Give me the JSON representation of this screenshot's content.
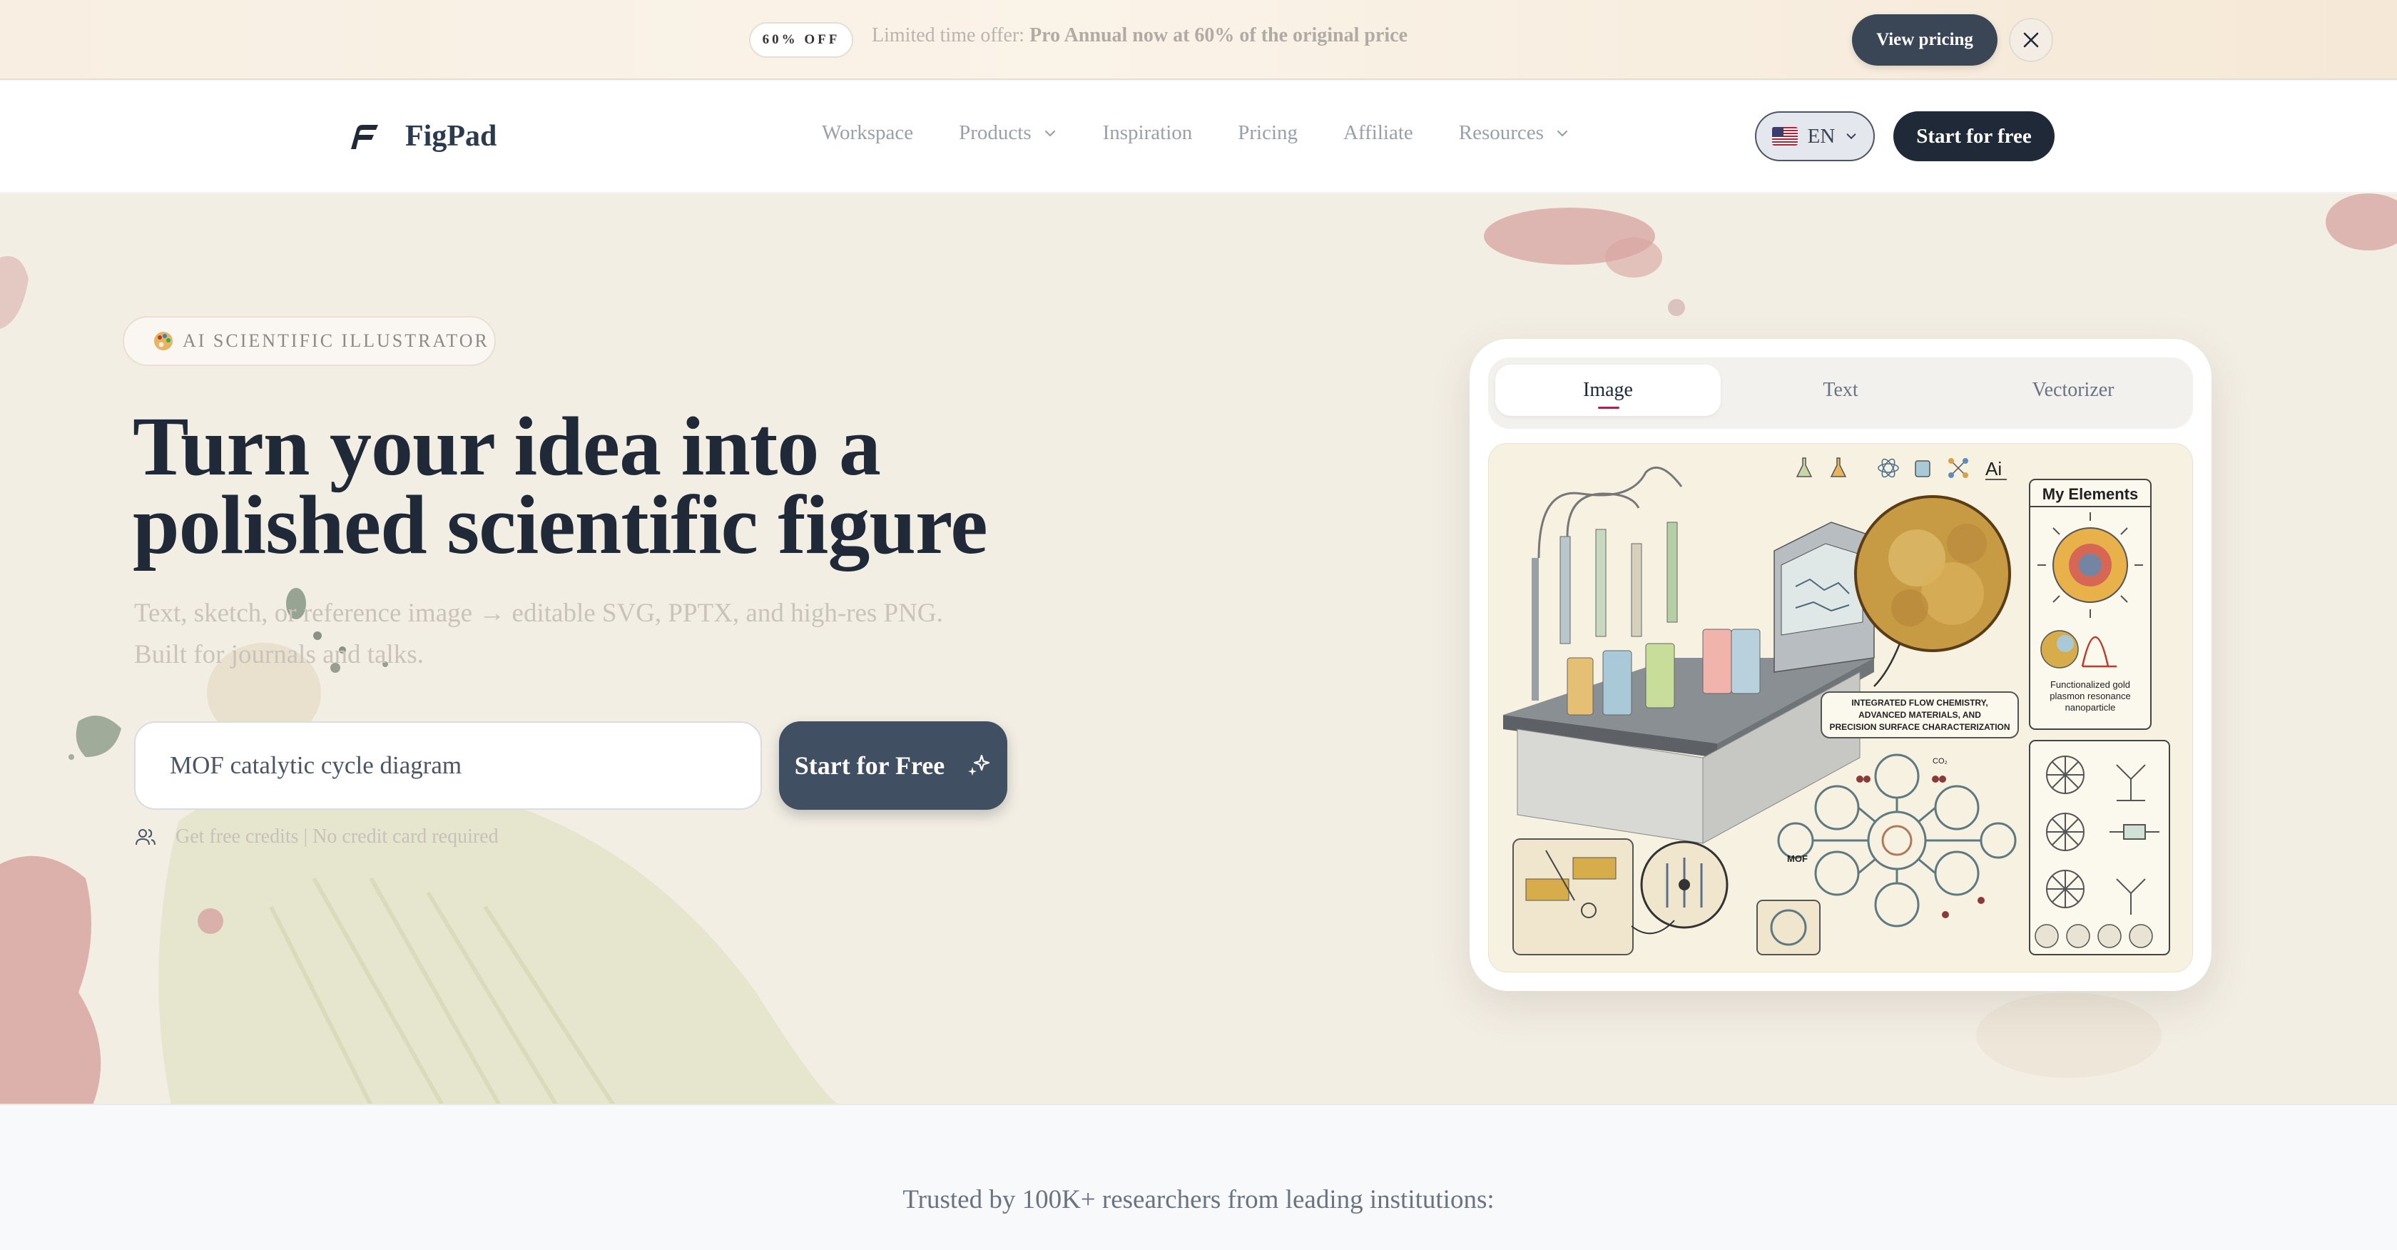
{
  "promo": {
    "badge": "60% OFF",
    "text_prefix": "Limited time offer: ",
    "text_bold": "Pro Annual now at 60% of the original price",
    "button": "View pricing",
    "close_icon": "close-icon"
  },
  "nav": {
    "brand": "FigPad",
    "links": [
      {
        "label": "Workspace",
        "dropdown": false
      },
      {
        "label": "Products",
        "dropdown": true
      },
      {
        "label": "Inspiration",
        "dropdown": false
      },
      {
        "label": "Pricing",
        "dropdown": false
      },
      {
        "label": "Affiliate",
        "dropdown": false
      },
      {
        "label": "Resources",
        "dropdown": true
      }
    ],
    "language": "EN",
    "cta": "Start for free"
  },
  "hero": {
    "pill": "AI SCIENTIFIC ILLUSTRATOR",
    "title_line1": "Turn your idea into a",
    "title_line2": "polished scientific figure",
    "subtitle_line1": "Text, sketch, or reference image → editable SVG, PPTX, and high-res PNG.",
    "subtitle_line2": "Built for journals and talks.",
    "input_value": "MOF catalytic cycle diagram",
    "cta": "Start for Free",
    "note": "Get free credits | No credit card required"
  },
  "demo": {
    "tabs": [
      "Image",
      "Text",
      "Vectorizer"
    ],
    "active_tab": "Image",
    "canvas": {
      "toolbar_ai": "Ai",
      "elements_title": "My Elements",
      "element_caption_1": "Functionalized gold",
      "element_caption_2": "plasmon resonance",
      "element_caption_3": "nanoparticle",
      "callout_1": "INTEGRATED FLOW CHEMISTRY,",
      "callout_2": "ADVANCED MATERIALS, AND",
      "callout_3": "PRECISION SURFACE CHARACTERIZATION",
      "mof_label": "MOF",
      "co2_label": "CO₂"
    }
  },
  "trusted": "Trusted by 100K+ researchers from leading institutions:",
  "colors": {
    "navy": "#1f2937",
    "slate": "#414f62",
    "accent": "#9b2c4a"
  }
}
